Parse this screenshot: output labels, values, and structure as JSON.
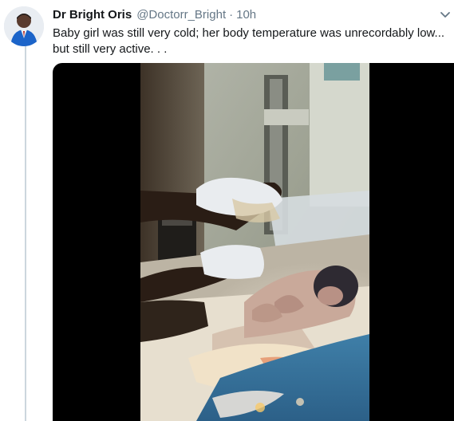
{
  "tweet": {
    "author_name": "Dr Bright Oris",
    "handle": "@Doctorr_Bright",
    "separator": "·",
    "time": "10h",
    "text": "Baby girl was still very cold; her body temperature was unrecordably low...\nbut still very active. . .",
    "menu_icon": "chevron-down-icon",
    "avatar_icon": "avatar"
  },
  "colors": {
    "secondary_text": "#657786",
    "primary_text": "#14171a",
    "thread_line": "#ccd6dd",
    "media_background": "#000000"
  }
}
